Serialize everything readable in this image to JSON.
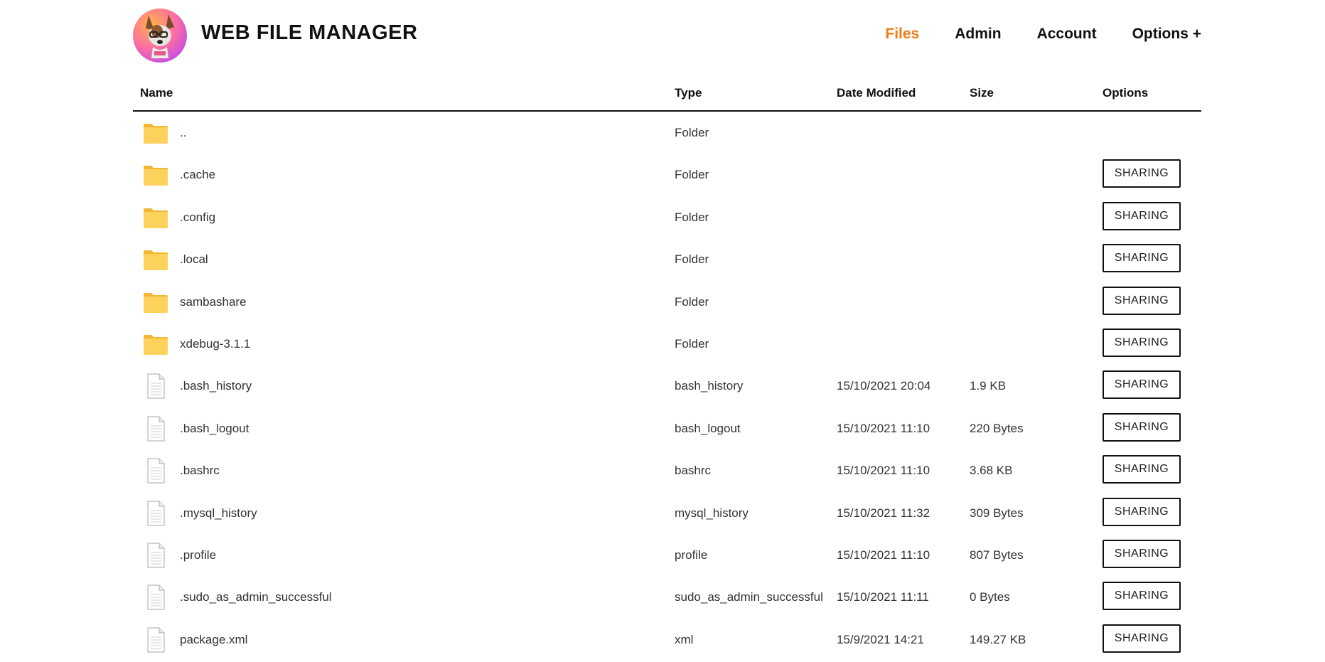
{
  "app": {
    "title": "WEB FILE MANAGER"
  },
  "nav": {
    "items": [
      {
        "label": "Files",
        "active": true
      },
      {
        "label": "Admin",
        "active": false
      },
      {
        "label": "Account",
        "active": false
      },
      {
        "label": "Options +",
        "active": false
      }
    ]
  },
  "table": {
    "columns": [
      "Name",
      "Type",
      "Date Modified",
      "Size",
      "Options"
    ],
    "share_label": "SHARING",
    "rows": [
      {
        "name": "..",
        "type": "Folder",
        "date": "",
        "size": "",
        "icon": "folder-icon",
        "sharing": false
      },
      {
        "name": ".cache",
        "type": "Folder",
        "date": "",
        "size": "",
        "icon": "folder-icon",
        "sharing": true
      },
      {
        "name": ".config",
        "type": "Folder",
        "date": "",
        "size": "",
        "icon": "folder-icon",
        "sharing": true
      },
      {
        "name": ".local",
        "type": "Folder",
        "date": "",
        "size": "",
        "icon": "folder-icon",
        "sharing": true
      },
      {
        "name": "sambashare",
        "type": "Folder",
        "date": "",
        "size": "",
        "icon": "folder-icon",
        "sharing": true
      },
      {
        "name": "xdebug-3.1.1",
        "type": "Folder",
        "date": "",
        "size": "",
        "icon": "folder-icon",
        "sharing": true
      },
      {
        "name": ".bash_history",
        "type": "bash_history",
        "date": "15/10/2021 20:04",
        "size": "1.9 KB",
        "icon": "file-icon",
        "sharing": true
      },
      {
        "name": ".bash_logout",
        "type": "bash_logout",
        "date": "15/10/2021 11:10",
        "size": "220 Bytes",
        "icon": "file-icon",
        "sharing": true
      },
      {
        "name": ".bashrc",
        "type": "bashrc",
        "date": "15/10/2021 11:10",
        "size": "3.68 KB",
        "icon": "file-icon",
        "sharing": true
      },
      {
        "name": ".mysql_history",
        "type": "mysql_history",
        "date": "15/10/2021 11:32",
        "size": "309 Bytes",
        "icon": "file-icon",
        "sharing": true
      },
      {
        "name": ".profile",
        "type": "profile",
        "date": "15/10/2021 11:10",
        "size": "807 Bytes",
        "icon": "file-icon",
        "sharing": true
      },
      {
        "name": ".sudo_as_admin_successful",
        "type": "sudo_as_admin_successful",
        "date": "15/10/2021 11:11",
        "size": "0 Bytes",
        "icon": "file-icon",
        "sharing": true
      },
      {
        "name": "package.xml",
        "type": "xml",
        "date": "15/9/2021 14:21",
        "size": "149.27 KB",
        "icon": "file-icon",
        "sharing": true
      }
    ]
  },
  "colors": {
    "accent": "#f07c16",
    "folder": "#fcd15c",
    "folder_dark": "#f3b630"
  }
}
